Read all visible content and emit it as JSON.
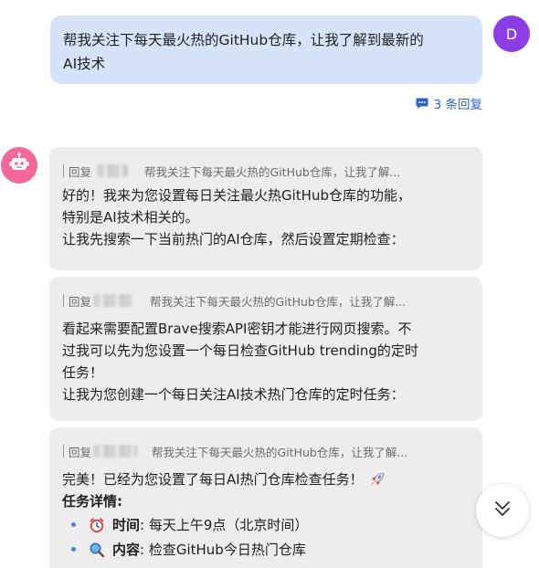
{
  "user_message": {
    "avatar_letter": "D",
    "line1": "帮我关注下每天最火热的GitHub仓库，让我了解到最新的",
    "line2": "AI技术",
    "reply_count": "3 条回复"
  },
  "replies": [
    {
      "prefix": "回复",
      "quote": "帮我关注下每天最火热的GitHub仓库，让我了解...",
      "lines": [
        "好的！我来为您设置每日关注最火热GitHub仓库的功能，",
        "特别是AI技术相关的。",
        "让我先搜索一下当前热门的AI仓库，然后设置定期检查："
      ]
    },
    {
      "prefix": "回复",
      "quote": "帮我关注下每天最火热的GitHub仓库，让我了解...",
      "lines": [
        "看起来需要配置Brave搜索API密钥才能进行网页搜索。不",
        "过我可以先为您设置一个每日检查GitHub trending的定时",
        "任务！",
        "让我为您创建一个每日关注AI技术热门仓库的定时任务："
      ]
    },
    {
      "prefix": "回复",
      "quote": "帮我关注下每天最火热的GitHub仓库，让我了解...",
      "line1": "完美！已经为您设置了每日AI热门仓库检查任务！",
      "detail_title": "任务详情:",
      "items": [
        {
          "icon": "alarm-clock-icon",
          "label": "时间",
          "value": ": 每天上午9点（北京时间）"
        },
        {
          "icon": "magnifier-icon",
          "label": "内容",
          "value": ": 检查GitHub今日热门仓库"
        }
      ]
    }
  ],
  "colors": {
    "user_bubble": "#d6e4fb",
    "bot_card": "#ededee",
    "user_avatar": "#8b3de8",
    "bot_avatar": "#f2699a",
    "link": "#2c64d6"
  }
}
